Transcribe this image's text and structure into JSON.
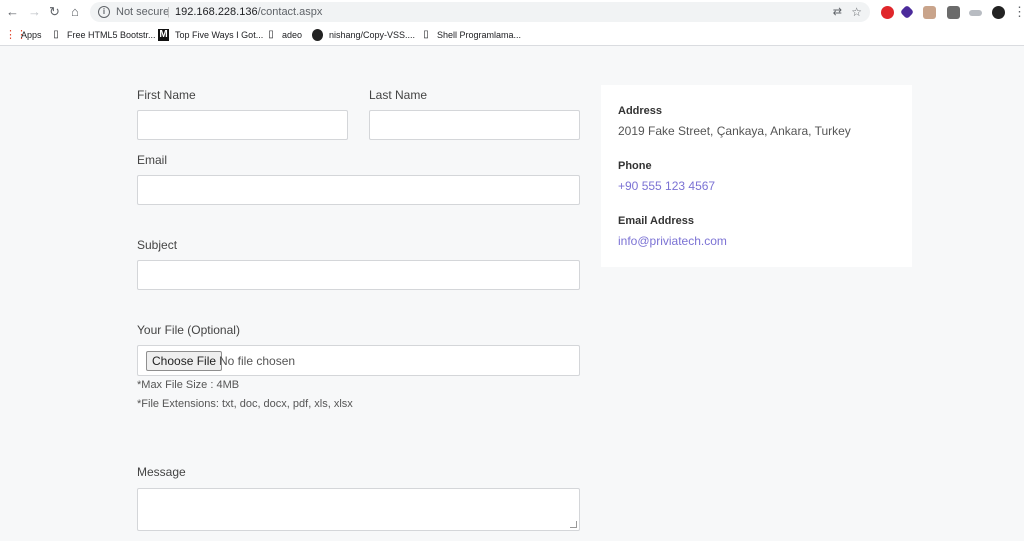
{
  "browser": {
    "back_icon": "arrow-left",
    "forward_icon": "arrow-right",
    "reload_icon": "reload",
    "home_icon": "home",
    "security_label": "Not secure",
    "url_host": "192.168.228.136",
    "url_path": "/contact.aspx",
    "bookmarks": [
      {
        "label": "Apps",
        "icon": "apps-grid"
      },
      {
        "label": "Free HTML5 Bootstr...",
        "icon": "page"
      },
      {
        "label": "Top Five Ways I Got...",
        "icon": "medium-logo"
      },
      {
        "label": "adeo",
        "icon": "page"
      },
      {
        "label": "nishang/Copy-VSS....",
        "icon": "github-logo"
      },
      {
        "label": "Shell Programlama...",
        "icon": "page"
      }
    ]
  },
  "form": {
    "first_name_label": "First Name",
    "last_name_label": "Last Name",
    "email_label": "Email",
    "subject_label": "Subject",
    "file_label": "Your File (Optional)",
    "file_button": "Choose File",
    "file_status": "No file chosen",
    "max_size_note": "*Max File Size : 4MB",
    "extensions_note": "*File Extensions: txt, doc, docx, pdf, xls, xlsx",
    "message_label": "Message"
  },
  "contact_info": {
    "address_heading": "Address",
    "address_text": "2019 Fake Street, Çankaya, Ankara, Turkey",
    "phone_heading": "Phone",
    "phone_text": "+90 555 123 4567",
    "email_heading": "Email Address",
    "email_text": "info@priviatech.com"
  },
  "colors": {
    "link": "#7b72d4",
    "page_background": "#f7f8f9"
  }
}
